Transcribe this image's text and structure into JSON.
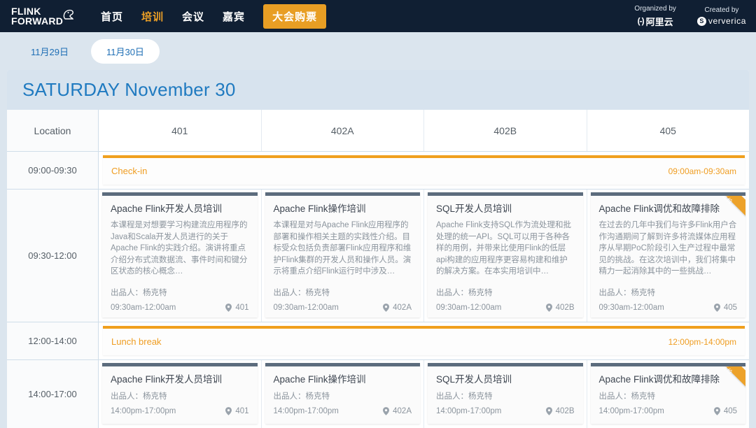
{
  "header": {
    "logo_line1": "FLINK",
    "logo_line2": "FORWARD",
    "nav": [
      {
        "label": "首页",
        "active": false
      },
      {
        "label": "培训",
        "active": true
      },
      {
        "label": "会议",
        "active": false
      },
      {
        "label": "嘉宾",
        "active": false
      }
    ],
    "cta_label": "大会购票",
    "sponsors": [
      {
        "label": "Organized by",
        "mark": "(-)",
        "name": "阿里云"
      },
      {
        "label": "Created by",
        "mark": "S",
        "name": "ververica"
      }
    ],
    "bg_color": "#101f33",
    "accent_color": "#e89e24"
  },
  "date_tabs": [
    {
      "label": "11月29日",
      "active": false
    },
    {
      "label": "11月30日",
      "active": true
    }
  ],
  "schedule": {
    "title_weekday": "SATURDAY",
    "title_date": "November 30",
    "title_color": "#1f7ac0",
    "location_header": "Location",
    "rooms": [
      "401",
      "402A",
      "402B",
      "405"
    ],
    "rows": [
      {
        "type": "banner",
        "time": "09:00-09:30",
        "label": "Check-in",
        "time_range": "09:00am-09:30am",
        "color": "#ef9d22"
      },
      {
        "type": "sessions",
        "time": "09:30-12:00",
        "cards": [
          {
            "title": "Apache Flink开发人员培训",
            "description": "本课程是对想要学习构建流应用程序的Java和Scala开发人员进行的关于Apache Flink的实践介绍。演讲将重点介绍分布式流数据流、事件时间和键分区状态的核心概念…",
            "presenter": "出品人：杨克特",
            "time_range": "09:30am-12:00am",
            "location": "401",
            "ribbon": ""
          },
          {
            "title": "Apache Flink操作培训",
            "description": "本课程是对与Apache Flink应用程序的部署和操作相关主题的实践性介绍。目标受众包括负责部署Flink应用程序和维护Flink集群的开发人员和操作人员。演示将重点介绍Flink运行时中涉及…",
            "presenter": "出品人：杨克特",
            "time_range": "09:30am-12:00am",
            "location": "402A",
            "ribbon": ""
          },
          {
            "title": "SQL开发人员培训",
            "description": "Apache Flink支持SQL作为流处理和批处理的统一API。SQL可以用于各种各样的用例，并带来比使用Flink的低层api构建的应用程序更容易构建和维护的解决方案。在本实用培训中…",
            "presenter": "出品人：杨克特",
            "time_range": "09:30am-12:00am",
            "location": "402B",
            "ribbon": ""
          },
          {
            "title": "Apache Flink调优和故障排除",
            "description": "在过去的几年中我们与许多Flink用户合作沟通期间了解到许多将流媒体应用程序从早期PoC阶段引入生产过程中最常见的挑战。在这次培训中，我们将集中精力一起消除其中的一些挑战…",
            "presenter": "出品人：杨克特",
            "time_range": "09:30am-12:00am",
            "location": "405",
            "ribbon": "最低价"
          }
        ]
      },
      {
        "type": "banner",
        "time": "12:00-14:00",
        "label": "Lunch break",
        "time_range": "12:00pm-14:00pm",
        "color": "#ef9d22"
      },
      {
        "type": "sessions_compact",
        "time": "14:00-17:00",
        "cards": [
          {
            "title": "Apache Flink开发人员培训",
            "presenter": "出品人：杨克特",
            "time_range": "14:00pm-17:00pm",
            "location": "401",
            "ribbon": ""
          },
          {
            "title": "Apache Flink操作培训",
            "presenter": "出品人：杨克特",
            "time_range": "14:00pm-17:00pm",
            "location": "402A",
            "ribbon": ""
          },
          {
            "title": "SQL开发人员培训",
            "presenter": "出品人：杨克特",
            "time_range": "14:00pm-17:00pm",
            "location": "402B",
            "ribbon": ""
          },
          {
            "title": "Apache Flink调优和故障排除",
            "presenter": "出品人：杨克特",
            "time_range": "14:00pm-17:00pm",
            "location": "405",
            "ribbon": "最低价"
          }
        ]
      }
    ]
  }
}
